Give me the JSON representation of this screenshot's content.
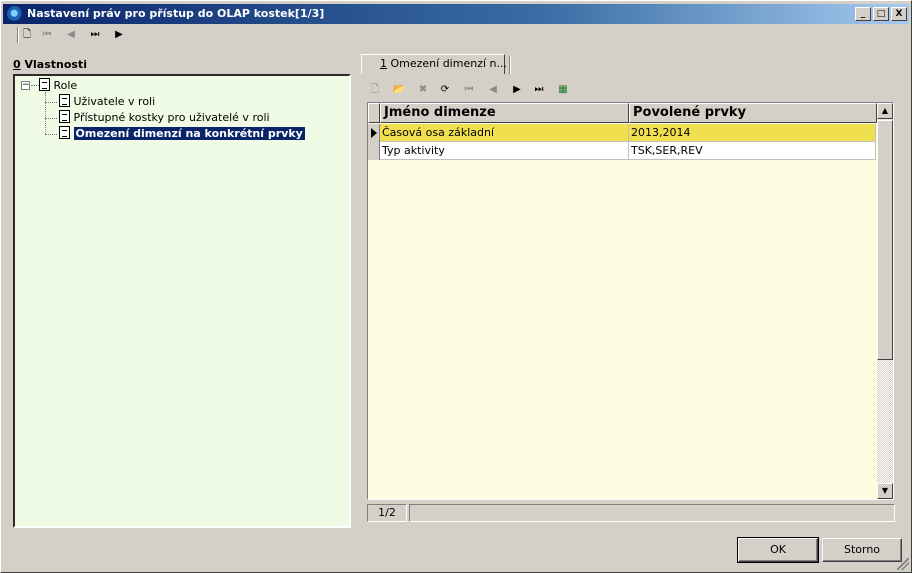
{
  "window": {
    "title": "Nastavení práv pro přístup do OLAP kostek[1/3]"
  },
  "title_buttons": {
    "minimize": "_",
    "maximize": "□",
    "close": "X"
  },
  "left_panel": {
    "label_key": "0",
    "label_rest": " Vlastnosti",
    "tree": {
      "root": "Role",
      "children": [
        "Uživatele v roli",
        "Přístupné kostky pro uživatelé v roli",
        "Omezení dimenzí na konkrétní prvky"
      ],
      "selected_index": 2
    }
  },
  "tab": {
    "key": "1",
    "label": " Omezení dimenzí n..."
  },
  "grid": {
    "columns": [
      "Jméno dimenze",
      "Povolené prvky"
    ],
    "rows": [
      [
        "Časová osa základní",
        "2013,2014"
      ],
      [
        "Typ aktivity",
        "TSK,SER,REV"
      ]
    ],
    "active_row": 0
  },
  "status": {
    "record": "1/2"
  },
  "buttons": {
    "ok": "OK",
    "cancel": "Storno"
  },
  "colors": {
    "tree_bg": "#f0fbe6",
    "grid_bg": "#fdfbe0",
    "active_row": "#f0e050",
    "selection": "#0a246a"
  }
}
